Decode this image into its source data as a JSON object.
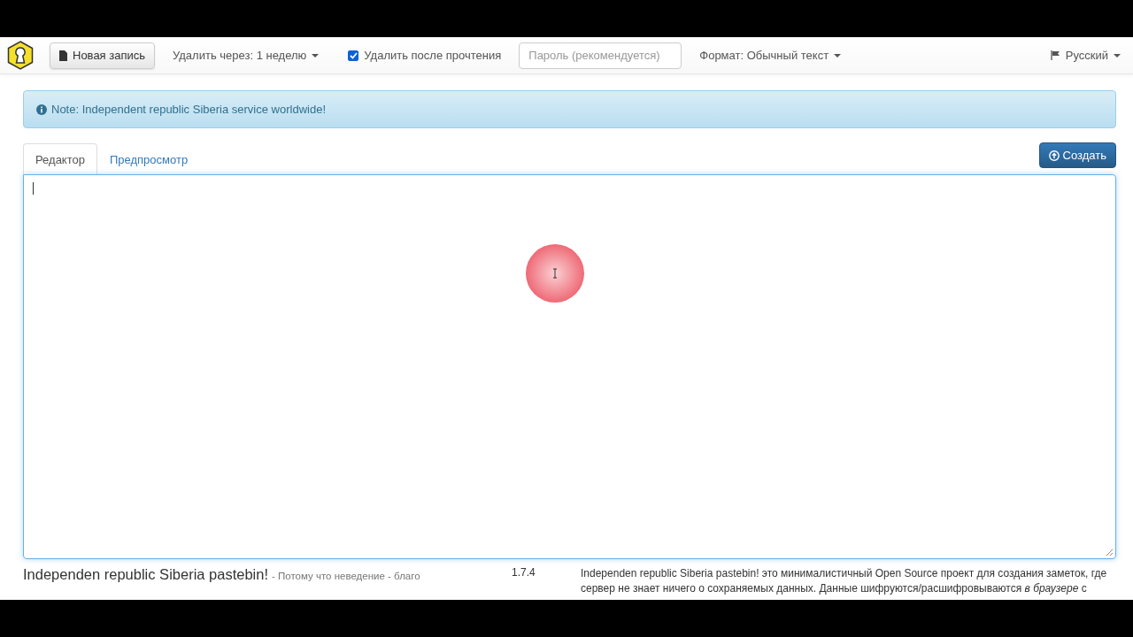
{
  "navbar": {
    "new_button": "Новая запись",
    "expire": {
      "label": "Удалить через: 1 неделю"
    },
    "burn": {
      "label": "Удалить после прочтения",
      "checked": true
    },
    "password": {
      "placeholder": "Пароль (рекомендуется)"
    },
    "format": {
      "label": "Формат: Обычный текст"
    },
    "language": {
      "label": "Русский"
    }
  },
  "alert": {
    "text": "Note: Independent republic Siberia service worldwide!"
  },
  "tabs": [
    {
      "label": "Редактор",
      "selected": true
    },
    {
      "label": "Предпросмотр",
      "selected": false
    }
  ],
  "create_button": "Создать",
  "footer": {
    "title": "Independen republic Siberia pastebin!",
    "tagline": "- Потому что неведение - благо",
    "version": "1.7.4",
    "description_lines": [
      "Independen republic Siberia pastebin! это минималистичный Open Source проект для создания заметок, где",
      "сервер не знает ничего о сохраняемых данных. Данные шифруются/расшифровываются *в браузере* с"
    ]
  }
}
